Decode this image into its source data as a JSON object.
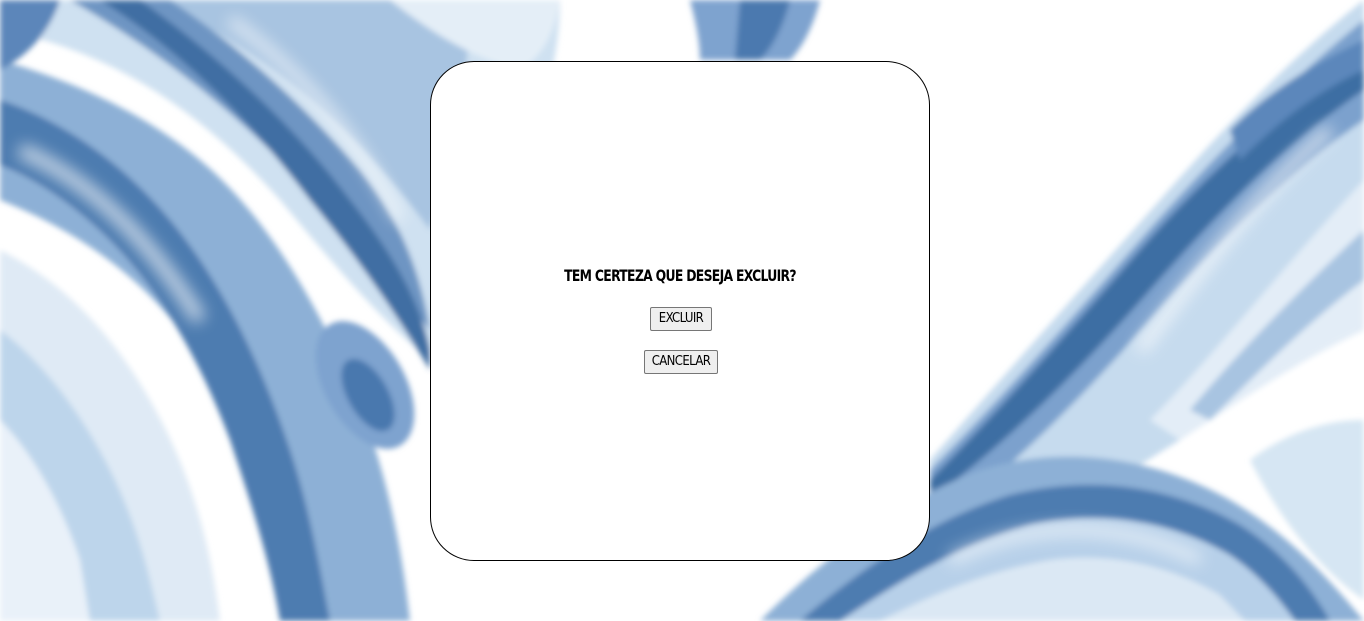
{
  "dialog": {
    "question": "TEM CERTEZA QUE DESEJA EXCLUIR?",
    "confirm_label": "EXCLUIR",
    "cancel_label": "CANCELAR"
  },
  "background": {
    "description_icon": "watercolor-waves",
    "colors": [
      "#3e6ea3",
      "#6f97c4",
      "#a9c6e2",
      "#d6e6f3",
      "#ffffff"
    ]
  }
}
